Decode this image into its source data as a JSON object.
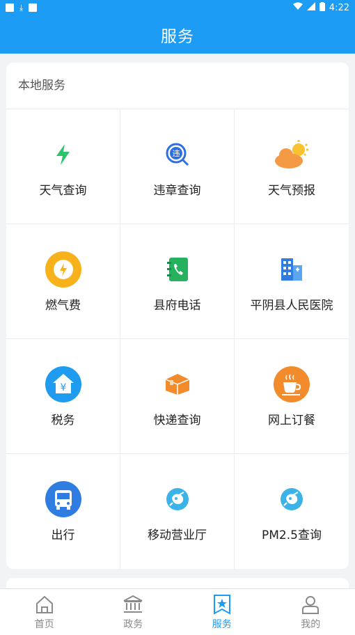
{
  "status_bar": {
    "time": "4:22"
  },
  "header": {
    "title": "服务"
  },
  "section": {
    "title": "本地服务"
  },
  "services": [
    {
      "label": "天气查询",
      "icon": "lightning-icon"
    },
    {
      "label": "违章查询",
      "icon": "violation-search-icon"
    },
    {
      "label": "天气预报",
      "icon": "sun-cloud-icon"
    },
    {
      "label": "燃气费",
      "icon": "gas-fee-icon"
    },
    {
      "label": "县府电话",
      "icon": "phone-book-icon"
    },
    {
      "label": "平阴县人民医院",
      "icon": "hospital-building-icon"
    },
    {
      "label": "税务",
      "icon": "tax-house-icon"
    },
    {
      "label": "快递查询",
      "icon": "package-box-icon"
    },
    {
      "label": "网上订餐",
      "icon": "coffee-cup-icon"
    },
    {
      "label": "出行",
      "icon": "bus-icon"
    },
    {
      "label": "移动营业厅",
      "icon": "mobile-hall-icon"
    },
    {
      "label": "PM2.5查询",
      "icon": "pm25-icon"
    }
  ],
  "tabbar": {
    "items": [
      {
        "label": "首页",
        "icon": "home-icon",
        "active": false
      },
      {
        "label": "政务",
        "icon": "government-icon",
        "active": false
      },
      {
        "label": "服务",
        "icon": "service-star-icon",
        "active": true
      },
      {
        "label": "我的",
        "icon": "user-icon",
        "active": false
      }
    ]
  },
  "colors": {
    "primary": "#1c9cf4",
    "text": "#222222",
    "muted": "#8a8a8a"
  }
}
